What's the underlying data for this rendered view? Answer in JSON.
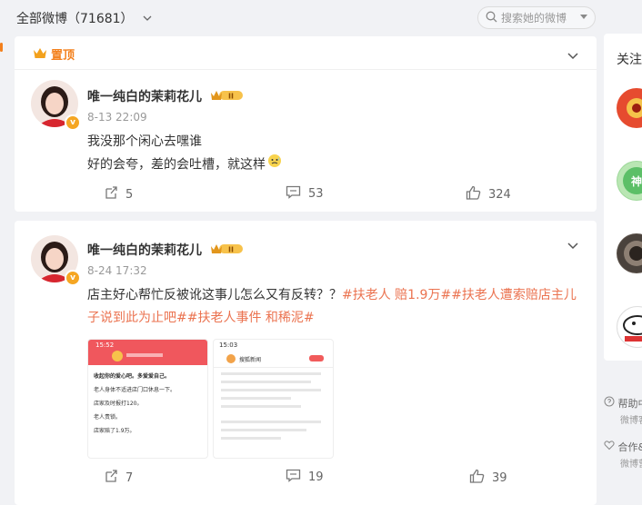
{
  "header": {
    "all_weibo_label": "全部微博（71681）",
    "search_placeholder": "搜索她的微博"
  },
  "posts": [
    {
      "pinned_label": "置顶",
      "user": "唯一纯白的茉莉花儿",
      "time": "8-13 22:09",
      "lines": [
        "我没那个闲心去嘿谁",
        "好的会夸，差的会吐槽，就这样"
      ],
      "reposts": "5",
      "comments": "53",
      "likes": "324"
    },
    {
      "user": "唯一纯白的茉莉花儿",
      "time": "8-24 17:32",
      "text_plain": "店主好心帮忙反被讹这事儿怎么又有反转？？",
      "tags": [
        "#扶老人 赔1.9万#",
        "#扶老人遭索赔店主儿子说到此为止吧#",
        "#扶老人事件 和稀泥#"
      ],
      "reposts": "7",
      "comments": "19",
      "likes": "39",
      "images": [
        {
          "status_time": "15:52",
          "lines": [
            "收起你的爱心吧。多爱爱自己。",
            "老人身体不适进店门口休息一下。",
            "店家及时报打120。",
            "老人责锁。",
            "店家赔了1.9万。"
          ]
        },
        {
          "status_time": "15:03",
          "tab": "搜狐新闻"
        }
      ]
    }
  ],
  "right_panel": {
    "title": "关注",
    "footer": [
      {
        "label": "帮助中",
        "sub": "微博客"
      },
      {
        "label": "合作&",
        "sub": "微博营"
      }
    ]
  },
  "colors": {
    "accent": "#eb7350",
    "pin": "#f3801c",
    "vip": "#f5a623"
  }
}
